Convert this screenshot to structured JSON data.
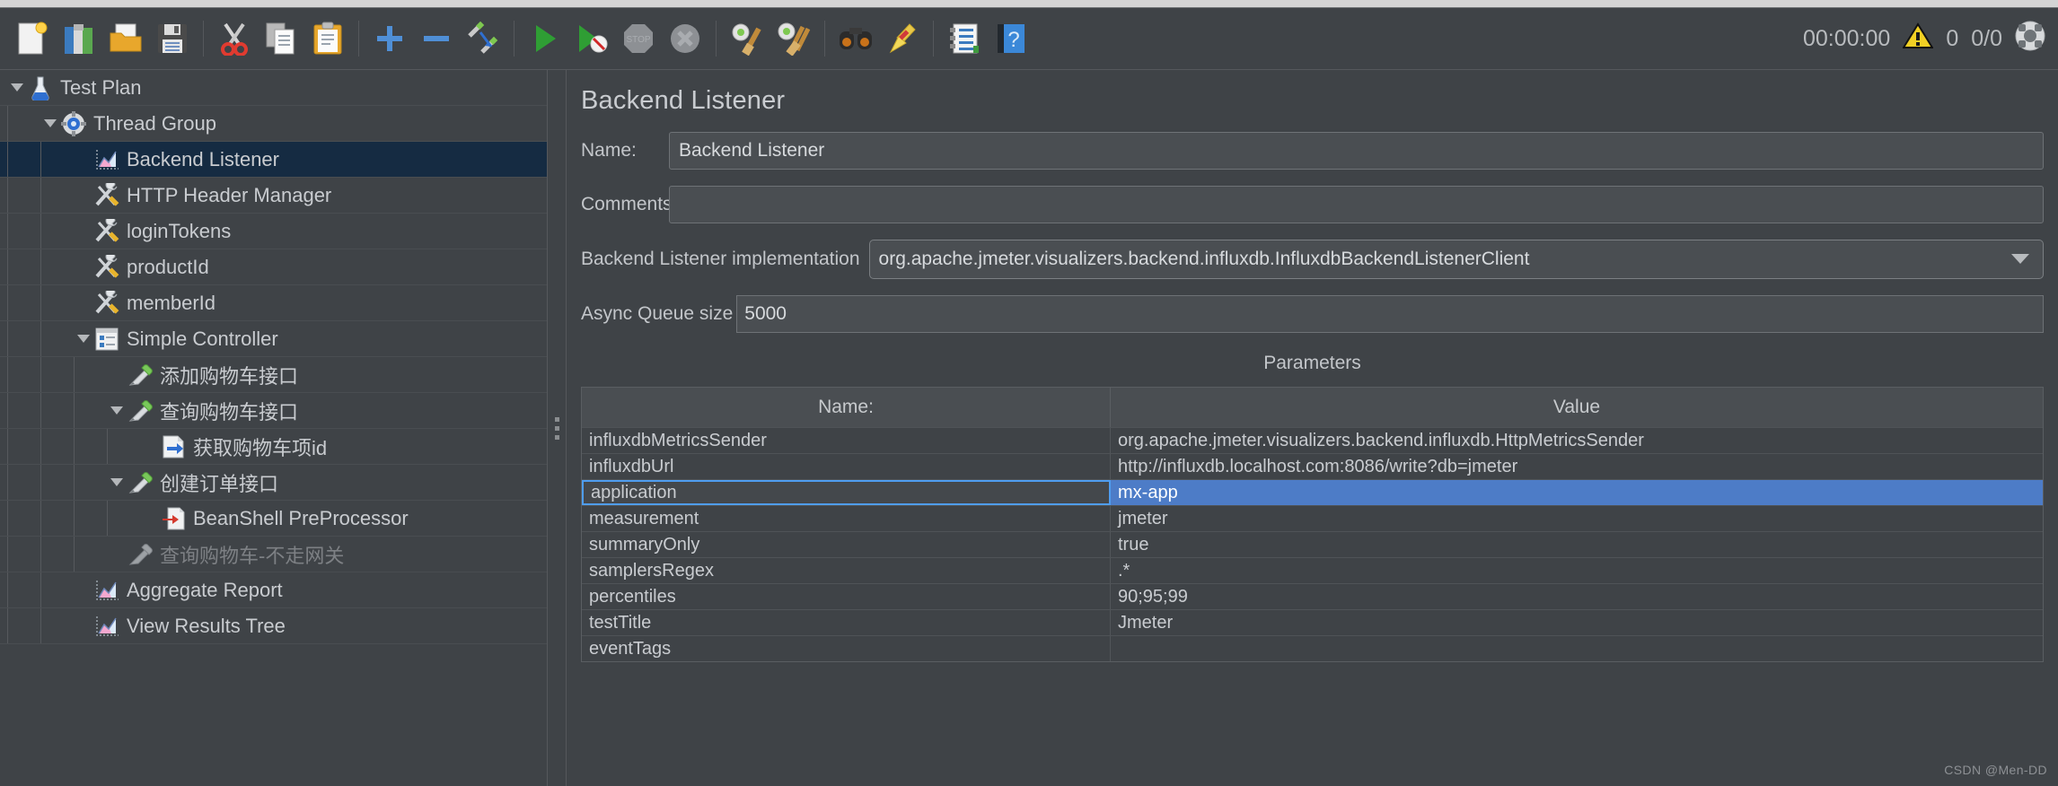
{
  "toolbar": {
    "buttons": [
      {
        "name": "new-icon",
        "label": "New"
      },
      {
        "name": "templates-icon",
        "label": "Templates"
      },
      {
        "name": "open-icon",
        "label": "Open"
      },
      {
        "name": "save-icon",
        "label": "Save Test Plan"
      },
      {
        "name": "cut-icon",
        "label": "Cut"
      },
      {
        "name": "copy-icon",
        "label": "Copy"
      },
      {
        "name": "paste-icon",
        "label": "Paste"
      },
      {
        "name": "expand-all-icon",
        "label": "Expand All"
      },
      {
        "name": "collapse-all-icon",
        "label": "Collapse All"
      },
      {
        "name": "toggle-icon",
        "label": "Toggle"
      },
      {
        "name": "start-icon",
        "label": "Start"
      },
      {
        "name": "start-no-pauses-icon",
        "label": "Start no pauses"
      },
      {
        "name": "stop-icon",
        "label": "Stop"
      },
      {
        "name": "shutdown-icon",
        "label": "Shutdown"
      },
      {
        "name": "clear-icon",
        "label": "Clear"
      },
      {
        "name": "clear-all-icon",
        "label": "Clear All"
      },
      {
        "name": "search-icon",
        "label": "Search"
      },
      {
        "name": "reset-search-icon",
        "label": "Reset Search"
      },
      {
        "name": "function-helper-icon",
        "label": "Function Helper Dialog"
      },
      {
        "name": "help-icon",
        "label": "Help"
      }
    ],
    "status": {
      "elapsed": "00:00:00",
      "warnings": "0",
      "threads": "0/0"
    }
  },
  "tree": {
    "items": [
      {
        "label": "Test Plan",
        "icon": "test-plan-icon",
        "depth": 0,
        "twisty": "expanded",
        "selected": false,
        "disabled": false
      },
      {
        "label": "Thread Group",
        "icon": "thread-group-icon",
        "depth": 1,
        "twisty": "expanded",
        "selected": false,
        "disabled": false
      },
      {
        "label": "Backend Listener",
        "icon": "listener-icon",
        "depth": 2,
        "twisty": "none",
        "selected": true,
        "disabled": false
      },
      {
        "label": "HTTP Header Manager",
        "icon": "config-icon",
        "depth": 2,
        "twisty": "none",
        "selected": false,
        "disabled": false
      },
      {
        "label": "loginTokens",
        "icon": "config-icon",
        "depth": 2,
        "twisty": "none",
        "selected": false,
        "disabled": false
      },
      {
        "label": "productId",
        "icon": "config-icon",
        "depth": 2,
        "twisty": "none",
        "selected": false,
        "disabled": false
      },
      {
        "label": "memberId",
        "icon": "config-icon",
        "depth": 2,
        "twisty": "none",
        "selected": false,
        "disabled": false
      },
      {
        "label": "Simple Controller",
        "icon": "controller-icon",
        "depth": 2,
        "twisty": "expanded",
        "selected": false,
        "disabled": false
      },
      {
        "label": "添加购物车接口",
        "icon": "sampler-icon",
        "depth": 3,
        "twisty": "none",
        "selected": false,
        "disabled": false
      },
      {
        "label": "查询购物车接口",
        "icon": "sampler-icon",
        "depth": 3,
        "twisty": "expanded",
        "selected": false,
        "disabled": false
      },
      {
        "label": "获取购物车项id",
        "icon": "postprocessor-icon",
        "depth": 4,
        "twisty": "none",
        "selected": false,
        "disabled": false
      },
      {
        "label": "创建订单接口",
        "icon": "sampler-icon",
        "depth": 3,
        "twisty": "expanded",
        "selected": false,
        "disabled": false
      },
      {
        "label": "BeanShell PreProcessor",
        "icon": "preprocessor-icon",
        "depth": 4,
        "twisty": "none",
        "selected": false,
        "disabled": false
      },
      {
        "label": "查询购物车-不走网关",
        "icon": "sampler-disabled-icon",
        "depth": 3,
        "twisty": "none",
        "selected": false,
        "disabled": true
      },
      {
        "label": "Aggregate Report",
        "icon": "listener-icon",
        "depth": 2,
        "twisty": "none",
        "selected": false,
        "disabled": false
      },
      {
        "label": "View Results Tree",
        "icon": "listener-icon",
        "depth": 2,
        "twisty": "none",
        "selected": false,
        "disabled": false
      }
    ]
  },
  "detail": {
    "title": "Backend Listener",
    "name_label": "Name:",
    "name_value": "Backend Listener",
    "comments_label": "Comments:",
    "comments_value": "",
    "implementation_label": "Backend Listener implementation",
    "implementation_value": "org.apache.jmeter.visualizers.backend.influxdb.InfluxdbBackendListenerClient",
    "queue_label": "Async Queue size",
    "queue_value": "5000",
    "parameters_title": "Parameters",
    "table": {
      "headers": [
        "Name:",
        "Value"
      ],
      "rows": [
        {
          "name": "influxdbMetricsSender",
          "value": "org.apache.jmeter.visualizers.backend.influxdb.HttpMetricsSender",
          "selected": false
        },
        {
          "name": "influxdbUrl",
          "value": "http://influxdb.localhost.com:8086/write?db=jmeter",
          "selected": false
        },
        {
          "name": "application",
          "value": "mx-app",
          "selected": true
        },
        {
          "name": "measurement",
          "value": "jmeter",
          "selected": false
        },
        {
          "name": "summaryOnly",
          "value": "true",
          "selected": false
        },
        {
          "name": "samplersRegex",
          "value": ".*",
          "selected": false
        },
        {
          "name": "percentiles",
          "value": "90;95;99",
          "selected": false
        },
        {
          "name": "testTitle",
          "value": "Jmeter",
          "selected": false
        },
        {
          "name": "eventTags",
          "value": "",
          "selected": false
        }
      ]
    }
  },
  "watermark": "CSDN @Men-DD",
  "colors": {
    "background": "#3f4347",
    "tree_selection": "#152b42",
    "table_selection": "#4d7cc7",
    "focus_border": "#4f9df0",
    "text": "#c9ccd0"
  }
}
